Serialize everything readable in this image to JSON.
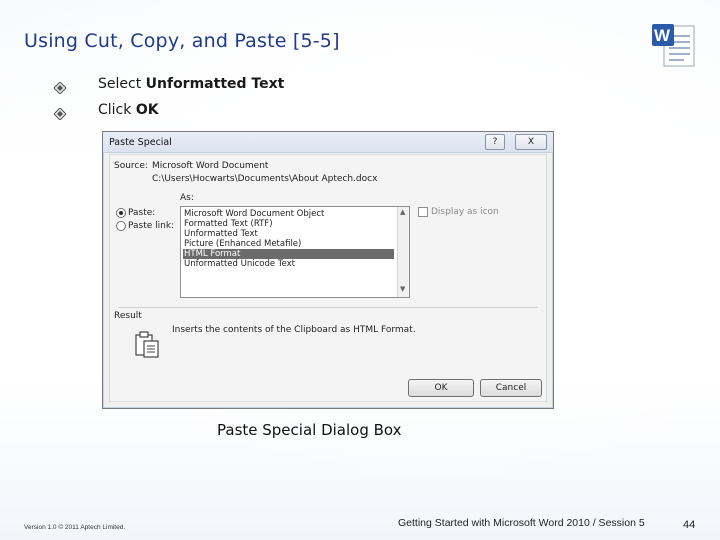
{
  "slide": {
    "title": "Using Cut, Copy, and Paste [5-5]",
    "caption": "Paste Special Dialog Box",
    "bullets": [
      {
        "prefix": "Select ",
        "bold": "Unformatted Text"
      },
      {
        "prefix": "Click ",
        "bold": "OK"
      }
    ],
    "footer": {
      "version": "Version 1.0 © 2011 Aptech Limited.",
      "course": "Getting Started with Microsoft Word 2010 / Session 5",
      "page": "44"
    }
  },
  "dialog": {
    "title": "Paste Special",
    "help_label": "?",
    "close_label": "X",
    "source_label": "Source:",
    "source_value": "Microsoft Word Document",
    "source_path": "C:\\Users\\Hocwarts\\Documents\\About Aptech.docx",
    "as_label": "As:",
    "radio_paste": "Paste:",
    "radio_paste_link": "Paste link:",
    "options": [
      "Microsoft Word Document Object",
      "Formatted Text (RTF)",
      "Unformatted Text",
      "Picture (Enhanced Metafile)",
      "HTML Format",
      "Unformatted Unicode Text"
    ],
    "selected_option": "HTML Format",
    "display_as_icon": "Display as icon",
    "result_label": "Result",
    "result_text": "Inserts the contents of the Clipboard as HTML Format.",
    "ok_label": "OK",
    "cancel_label": "Cancel"
  },
  "colors": {
    "title": "#1f3a8a",
    "selection": "#6b6b6b"
  }
}
